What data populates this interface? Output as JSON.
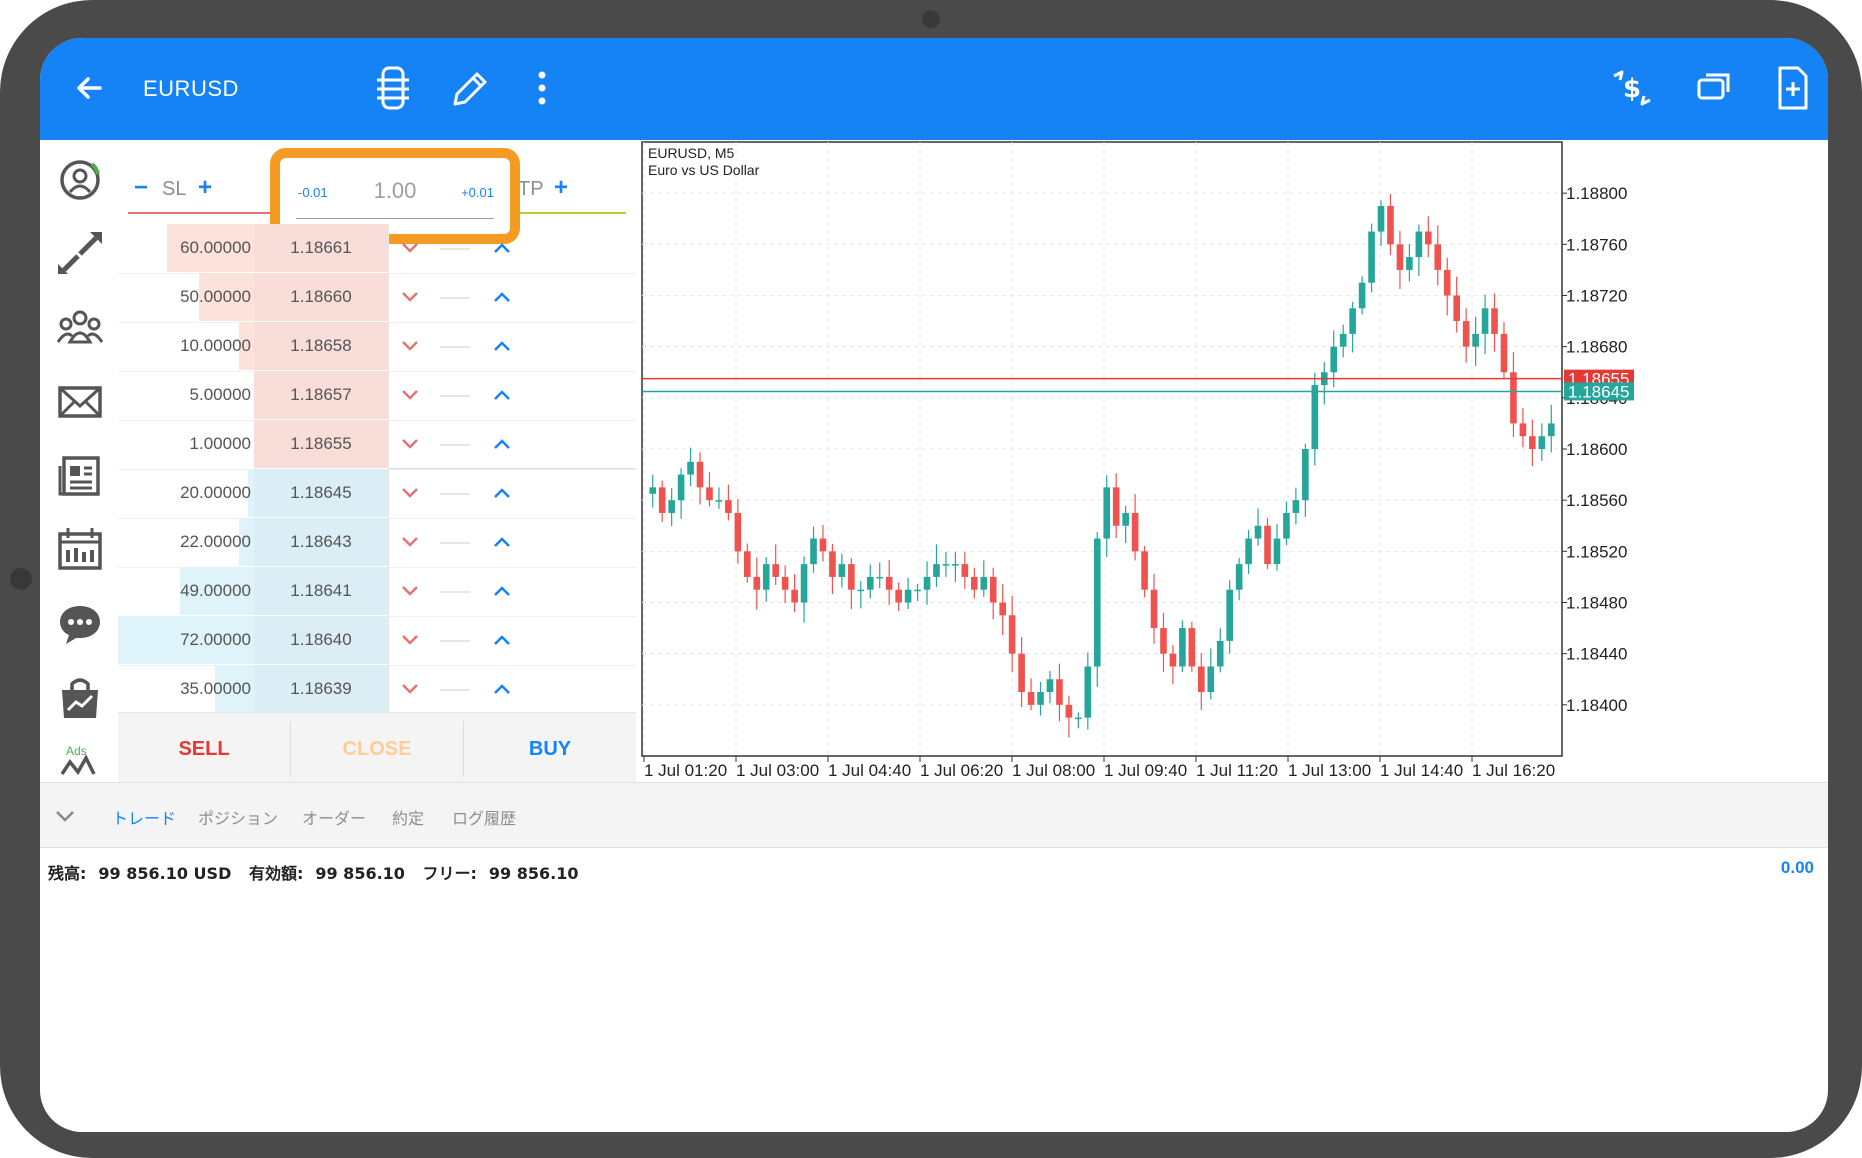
{
  "toolbar": {
    "symbol": "EURUSD",
    "icons": [
      "back-arrow-icon",
      "one-click-trading-icon",
      "drawing-pencil-icon",
      "more-vertical-icon",
      "trade-dollar-icon",
      "window-icon",
      "new-order-icon"
    ]
  },
  "rail": {
    "icons": [
      "account-icon",
      "trade-arrows-icon",
      "community-icon",
      "mail-icon",
      "news-icon",
      "calendar-icon",
      "chat-icon",
      "market-icon",
      "signals-icon"
    ],
    "ads_label": "Ads"
  },
  "order": {
    "sl_label": "SL",
    "tp_label": "TP",
    "minus": "−",
    "plus": "+",
    "volume": "1.00",
    "vol_dec": "-0.01",
    "vol_inc": "+0.01",
    "sell_label": "SELL",
    "close_label": "CLOSE",
    "buy_label": "BUY",
    "colors": {
      "sell": "#e53935",
      "buy": "#1583f5",
      "close": "#ffcc99",
      "ask_bg": "#fde2dc",
      "bid_bg": "#dff3fb"
    }
  },
  "depth": {
    "asks": [
      {
        "volume": "60.00000",
        "price": "1.18661",
        "fill": 0.82
      },
      {
        "volume": "50.00000",
        "price": "1.18660",
        "fill": 0.7
      },
      {
        "volume": "10.00000",
        "price": "1.18658",
        "fill": 0.55
      },
      {
        "volume": "5.00000",
        "price": "1.18657",
        "fill": 0.48
      },
      {
        "volume": "1.00000",
        "price": "1.18655",
        "fill": 0.4
      }
    ],
    "bids": [
      {
        "volume": "20.00000",
        "price": "1.18645",
        "fill": 0.52
      },
      {
        "volume": "22.00000",
        "price": "1.18643",
        "fill": 0.55
      },
      {
        "volume": "49.00000",
        "price": "1.18641",
        "fill": 0.77
      },
      {
        "volume": "72.00000",
        "price": "1.18640",
        "fill": 1.0
      },
      {
        "volume": "35.00000",
        "price": "1.18639",
        "fill": 0.64
      }
    ]
  },
  "chart_data": {
    "type": "candlestick",
    "title": "EURUSD, M5",
    "subtitle": "Euro vs US Dollar",
    "y_ticks": [
      "1.18800",
      "1.18760",
      "1.18720",
      "1.18680",
      "1.18640",
      "1.18600",
      "1.18560",
      "1.18520",
      "1.18480",
      "1.18440",
      "1.18400"
    ],
    "y_tick_values": [
      1.188,
      1.1876,
      1.1872,
      1.1868,
      1.1864,
      1.186,
      1.1856,
      1.1852,
      1.1848,
      1.1844,
      1.184
    ],
    "ylim": [
      1.1836,
      1.1884
    ],
    "x_ticks": [
      "1 Jul 01:20",
      "1 Jul 03:00",
      "1 Jul 04:40",
      "1 Jul 06:20",
      "1 Jul 08:00",
      "1 Jul 09:40",
      "1 Jul 11:20",
      "1 Jul 13:00",
      "1 Jul 14:40",
      "1 Jul 16:20"
    ],
    "ask_line": {
      "value": 1.18655,
      "label": "1.18655",
      "color": "#e53935"
    },
    "bid_line": {
      "value": 1.18645,
      "label": "1.18645",
      "color": "#26a69a"
    },
    "up_color": "#26a69a",
    "down_color": "#ef5350",
    "close_series": [
      1.1857,
      1.1855,
      1.1856,
      1.1858,
      1.1859,
      1.1857,
      1.1856,
      1.1856,
      1.1855,
      1.1852,
      1.185,
      1.1849,
      1.1851,
      1.185,
      1.1849,
      1.1848,
      1.1851,
      1.1853,
      1.1852,
      1.185,
      1.1851,
      1.1849,
      1.1849,
      1.185,
      1.185,
      1.1849,
      1.1848,
      1.1849,
      1.1849,
      1.185,
      1.1851,
      1.1851,
      1.1851,
      1.185,
      1.1849,
      1.185,
      1.1848,
      1.1847,
      1.1844,
      1.1841,
      1.184,
      1.1841,
      1.1842,
      1.184,
      1.1839,
      1.1839,
      1.1843,
      1.1853,
      1.1857,
      1.1854,
      1.1855,
      1.1852,
      1.1849,
      1.1846,
      1.1844,
      1.1843,
      1.1846,
      1.1843,
      1.1841,
      1.1843,
      1.1845,
      1.1849,
      1.1851,
      1.1853,
      1.1854,
      1.1851,
      1.1853,
      1.1855,
      1.1856,
      1.186,
      1.1865,
      1.1866,
      1.1868,
      1.1869,
      1.1871,
      1.1873,
      1.1877,
      1.1879,
      1.1876,
      1.1874,
      1.1875,
      1.1877,
      1.1876,
      1.1874,
      1.1872,
      1.187,
      1.1868,
      1.1869,
      1.1871,
      1.1869,
      1.1866,
      1.1862,
      1.1861,
      1.186,
      1.1861,
      1.1862
    ]
  },
  "tabs": {
    "items": [
      "トレード",
      "ポジション",
      "オーダー",
      "約定",
      "ログ履歴"
    ],
    "active": 0
  },
  "summary": {
    "balance_label": "残高:",
    "balance_value": "99 856.10 USD",
    "equity_label": "有効額:",
    "equity_value": "99 856.10",
    "free_label": "フリー:",
    "free_value": "99 856.10",
    "profit": "0.00"
  }
}
